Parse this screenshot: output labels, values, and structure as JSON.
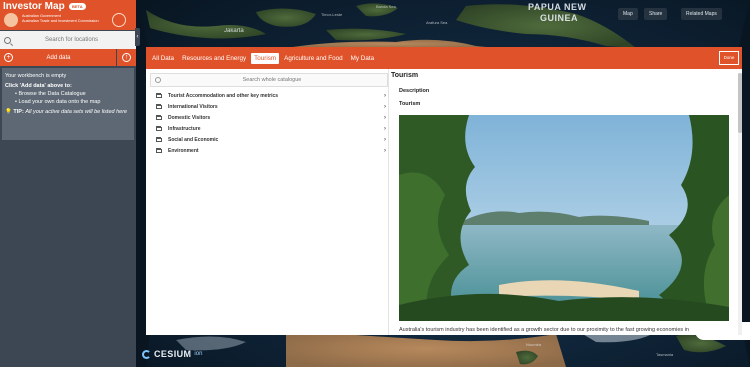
{
  "app": {
    "title": "Investor Map",
    "badge": "BETA",
    "gov_line1": "Australian Government",
    "gov_line2": "Australian Trade and Investment Commission",
    "accent": "#e0532a"
  },
  "workbench": {
    "search_placeholder": "Search for locations",
    "add_data_label": "Add data",
    "empty_heading": "Your workbench is empty",
    "instruction_heading": "Click 'Add data' above to:",
    "bullets": [
      "Browse the Data Catalogue",
      "Load your own data onto the map"
    ],
    "tip_label": "TIP:",
    "tip_text": "All your active data sets will be listed here"
  },
  "map": {
    "labels": {
      "png": "PAPUA NEW",
      "guinea": "GUINEA",
      "jakarta": "Jakarta",
      "arafura": "Arafura Sea",
      "banda": "Banda Sea",
      "timor": "Timor-Leste",
      "noumea": "Nouméa",
      "tasmania": "Tasmania"
    },
    "top_buttons": [
      "Map",
      "Share",
      "Related Maps"
    ],
    "credit": {
      "logo": "CESIUM",
      "suffix": "ion"
    }
  },
  "catalogue": {
    "tabs": [
      {
        "label": "All Data",
        "active": false
      },
      {
        "label": "Resources and Energy",
        "active": false
      },
      {
        "label": "Tourism",
        "active": true
      },
      {
        "label": "Agriculture and Food",
        "active": false
      },
      {
        "label": "My Data",
        "active": false
      }
    ],
    "done_label": "Done",
    "search_placeholder": "Search whole catalogue",
    "items": [
      "Tourist Accommodation and other key metrics",
      "International Visitors",
      "Domestic Visitors",
      "Infrastructure",
      "Social and Economic",
      "Environment"
    ]
  },
  "detail": {
    "title": "Tourism",
    "description_heading": "Description",
    "subheading": "Tourism",
    "paragraph": "Australia's tourism industry has been identified as a growth sector due to our proximity to the fast growing economies in"
  }
}
